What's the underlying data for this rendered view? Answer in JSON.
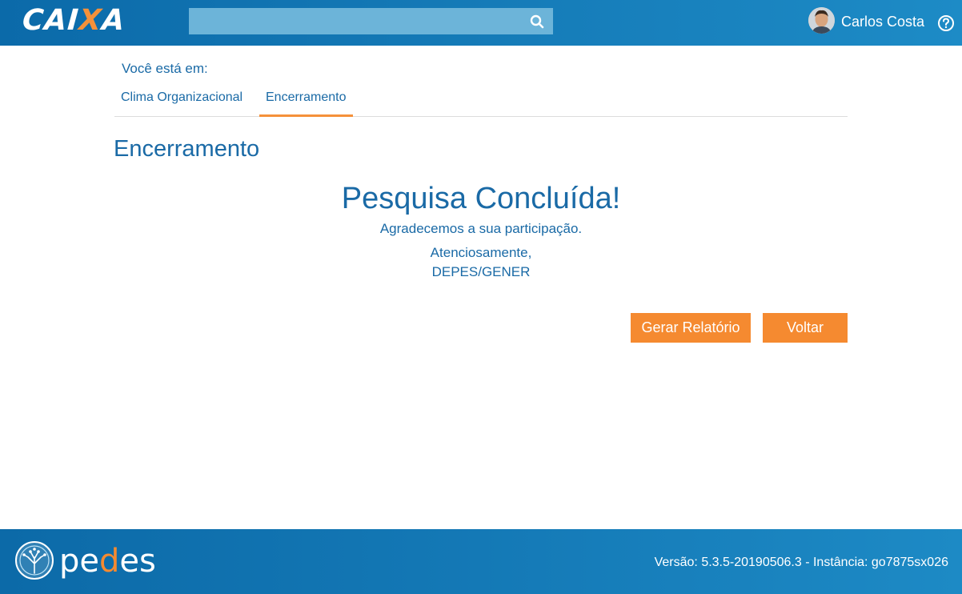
{
  "header": {
    "logo_prefix": "CAI",
    "logo_accent": "X",
    "logo_suffix": "A",
    "search": {
      "value": "",
      "placeholder": ""
    },
    "user_name": "Carlos Costa"
  },
  "breadcrumb": {
    "label": "Você está em:",
    "tabs": [
      {
        "label": "Clima Organizacional",
        "active": false
      },
      {
        "label": "Encerramento",
        "active": true
      }
    ]
  },
  "main": {
    "page_title": "Encerramento",
    "done_title": "Pesquisa Concluída!",
    "thanks": "Agradecemos a sua participação.",
    "regards": "Atenciosamente,",
    "dept": "DEPES/GENER",
    "buttons": {
      "report_label": "Gerar Relatório",
      "back_label": "Voltar"
    }
  },
  "footer": {
    "brand": "pedes",
    "version_text": "Versão: 5.3.5-20190506.3 - Instância: go7875sx026"
  },
  "colors": {
    "header_blue": "#0b6aa9",
    "text_blue": "#1a6aa6",
    "accent_orange": "#f58a30"
  },
  "icons": [
    "search-icon",
    "help-icon",
    "avatar",
    "pedes-tree-icon"
  ]
}
